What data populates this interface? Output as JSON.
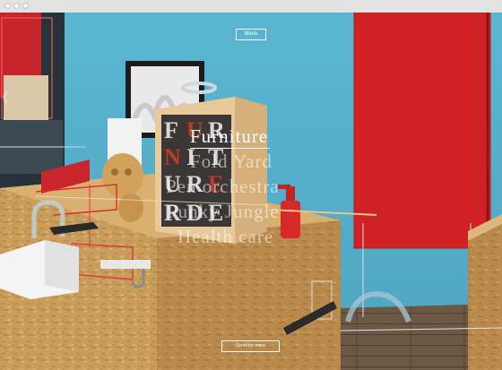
{
  "header": {
    "menu_label": "Menu"
  },
  "nav": {
    "items": [
      {
        "label": "Furniture",
        "active": true
      },
      {
        "label": "Fold Yard",
        "active": false
      },
      {
        "label": "Pen orchestra",
        "active": false
      },
      {
        "label": "Funky Jungle",
        "active": false
      },
      {
        "label": "Health care",
        "active": false
      }
    ]
  },
  "footer": {
    "scroll_label": "Scroll for more"
  },
  "colors": {
    "wall": "#58b3cf",
    "red_panel": "#d42227",
    "osb_wood": "#c79a55",
    "floor": "#6f5a48"
  }
}
